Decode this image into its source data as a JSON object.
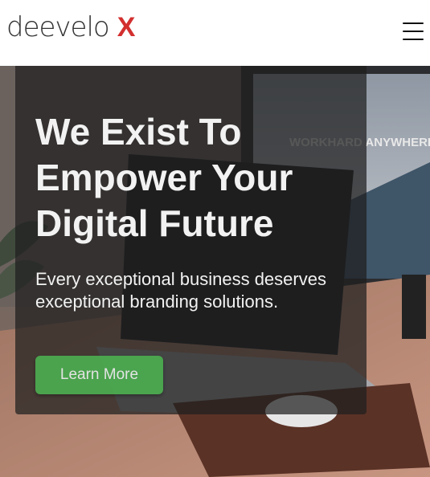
{
  "brand": {
    "name": "deevelo",
    "mark": "X",
    "mark_color": "#d32f2f"
  },
  "nav": {
    "menu_icon": "hamburger-icon"
  },
  "hero": {
    "headline": "We Exist To Empower Your Digital Future",
    "subtext": "Every exceptional business deserves exceptional branding solutions.",
    "cta_label": "Learn More",
    "cta_color": "#4caf50",
    "background_image": "desk-laptop-photo",
    "background_text": "WORKHARD ANYWHERE"
  }
}
